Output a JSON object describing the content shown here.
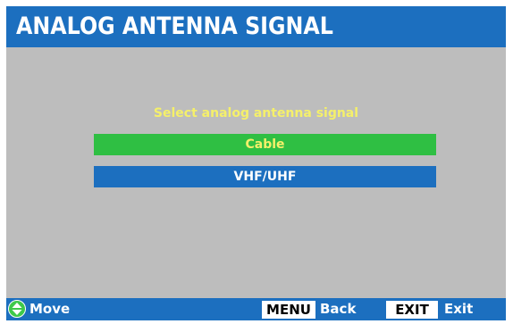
{
  "title": "ANALOG ANTENNA SIGNAL",
  "prompt": "Select analog antenna signal",
  "options": [
    {
      "label": "Cable",
      "selected": true
    },
    {
      "label": "VHF/UHF",
      "selected": false
    }
  ],
  "footer": {
    "move_icon": "up-down-arrows-icon",
    "move_label": "Move",
    "menu_key": "MENU",
    "menu_label": "Back",
    "exit_key": "EXIT",
    "exit_label": "Exit"
  },
  "colors": {
    "bar_blue": "#1c6fbf",
    "background_gray": "#bdbdbd",
    "selected_green": "#2fbf43",
    "highlight_yellow": "#f5f06a",
    "icon_green": "#3ec94a"
  }
}
